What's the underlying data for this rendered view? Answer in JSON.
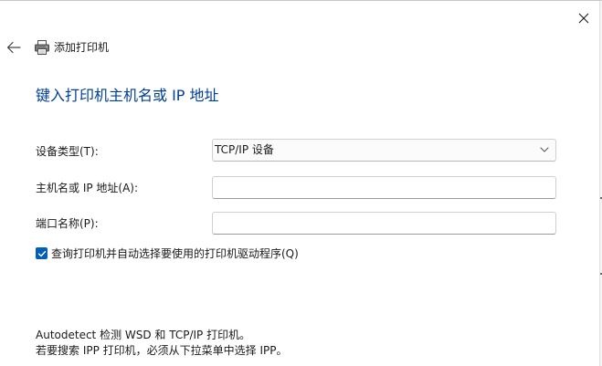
{
  "window": {
    "title": "添加打印机",
    "close_icon": "close-icon",
    "back_icon": "back-arrow-icon",
    "printer_icon": "printer-icon"
  },
  "page": {
    "heading": "键入打印机主机名或 IP 地址"
  },
  "form": {
    "device_type": {
      "label": "设备类型(T):",
      "selected": "TCP/IP 设备"
    },
    "hostname": {
      "label": "主机名或 IP 地址(A):",
      "value": ""
    },
    "port_name": {
      "label": "端口名称(P):",
      "value": ""
    },
    "auto_driver": {
      "checked": true,
      "label": "查询打印机并自动选择要使用的打印机驱动程序(Q)"
    }
  },
  "info": {
    "line1": "Autodetect 检测 WSD 和 TCP/IP 打印机。",
    "line2": "若要搜索 IPP 打印机，必须从下拉菜单中选择 IPP。"
  },
  "colors": {
    "heading": "#003e92",
    "accent": "#005fb8",
    "text": "#1a1a1a"
  }
}
